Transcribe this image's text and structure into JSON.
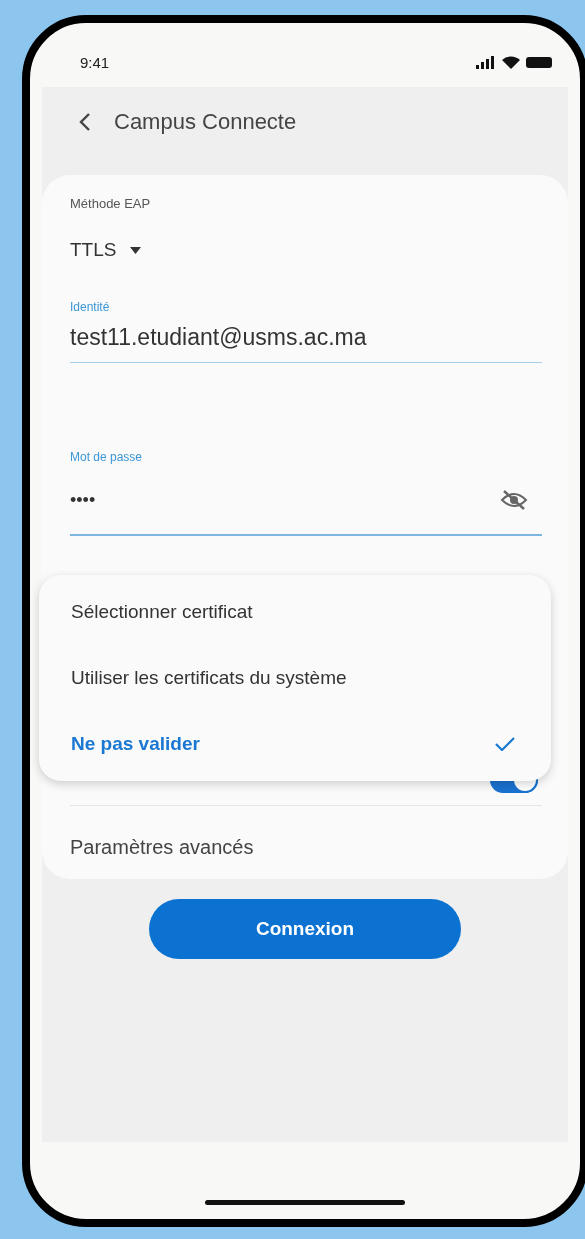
{
  "status_bar": {
    "time": "9:41"
  },
  "app_bar": {
    "title": "Campus Connecte"
  },
  "fields": [
    {
      "kind": "select",
      "label": "Méthode EAP",
      "value": "TTLS"
    },
    {
      "kind": "text",
      "label": "Identité",
      "value": "test11.etudiant@usms.ac.ma"
    },
    {
      "kind": "password",
      "label": "Mot de passe",
      "value": "••••"
    }
  ],
  "auto_reconnect": {
    "on": true
  },
  "certificate_menu": {
    "items": [
      {
        "label": "Sélectionner certificat",
        "selected": false
      },
      {
        "label": "Utiliser les certificats du système",
        "selected": false
      },
      {
        "label": "Ne pas valider",
        "selected": true
      }
    ]
  },
  "advanced_settings": {
    "label": "Paramètres avancés"
  },
  "connect_button": {
    "label": "Connexion"
  }
}
